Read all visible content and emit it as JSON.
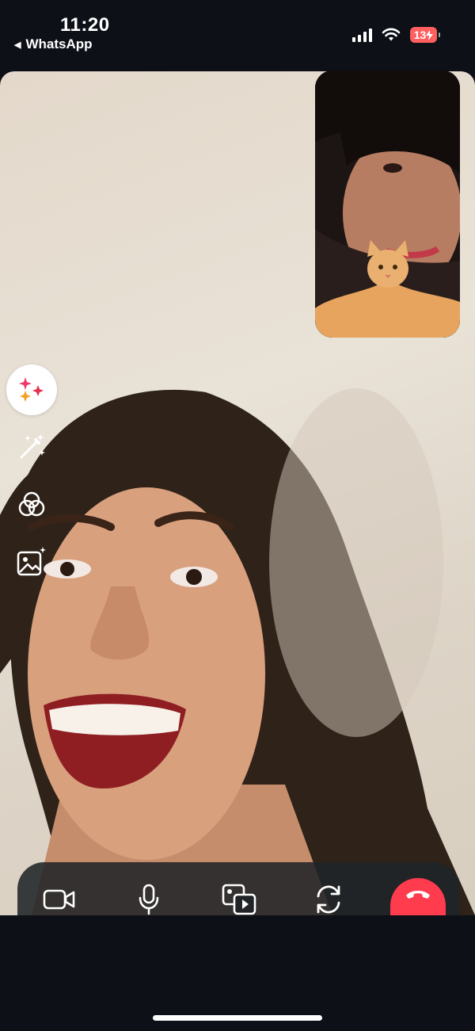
{
  "status_bar": {
    "time": "11:20",
    "back_app": "WhatsApp",
    "battery": "13",
    "signal_bars": 4,
    "battery_color": "#ff5f5f"
  },
  "call": {
    "main_video": "remote-participant",
    "pip_video": "self-view-with-cat"
  },
  "side_tools": [
    "effects-icon",
    "magic-wand-icon",
    "filters-icon",
    "background-icon"
  ],
  "controls": [
    "video-camera-icon",
    "microphone-icon",
    "share-screen-icon",
    "flip-camera-icon",
    "end-call-icon"
  ],
  "colors": {
    "end_call": "#ff3b4e",
    "control_bar": "#202428",
    "background": "#0d1117"
  }
}
